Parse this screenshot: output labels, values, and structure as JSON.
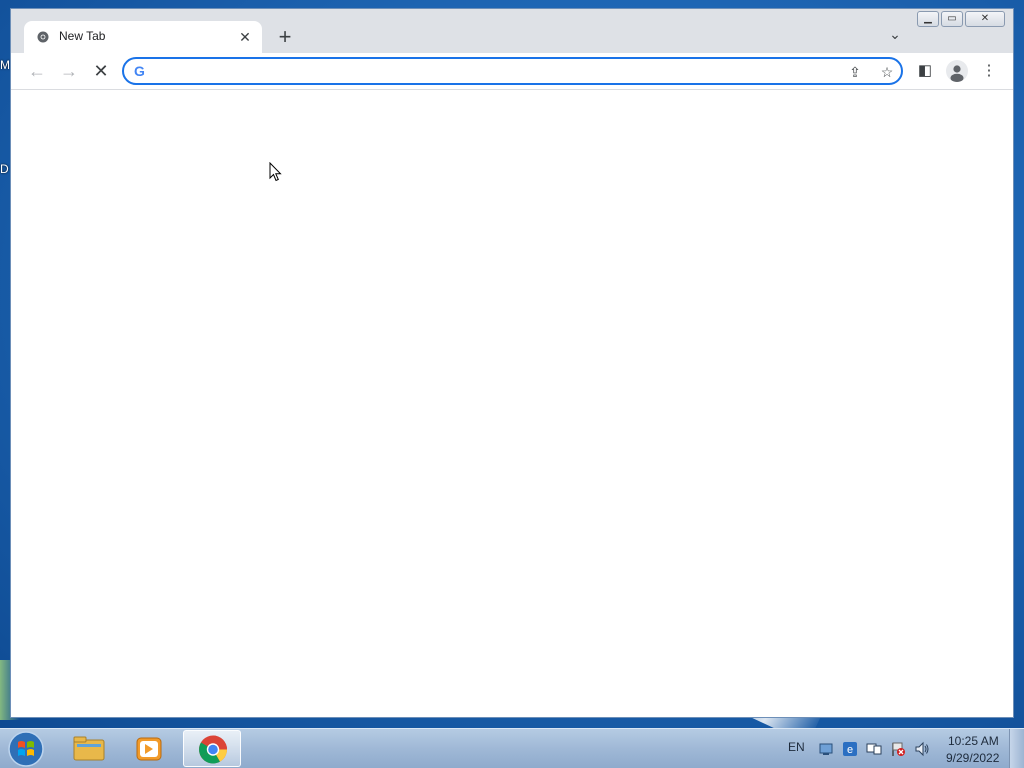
{
  "desktop": {
    "edge_letters": [
      "M",
      "D"
    ]
  },
  "browser": {
    "tab": {
      "title": "New Tab",
      "close_glyph": "✕"
    },
    "new_tab_glyph": "+",
    "tab_search_glyph": "⌄",
    "window_controls": {
      "minimize": "▁",
      "maximize": "▭",
      "close": "✕"
    },
    "toolbar": {
      "back_glyph": "←",
      "forward_glyph": "→",
      "stop_glyph": "✕",
      "omnibox_value": "",
      "omnibox_placeholder": "",
      "google_letter": "G",
      "share_glyph": "⇪",
      "bookmark_glyph": "☆",
      "side_panel_glyph": "◧",
      "menu_glyph": "⋮"
    }
  },
  "taskbar": {
    "language": "EN",
    "time": "10:25 AM",
    "date": "9/29/2022",
    "pinned": [
      "Windows Explorer",
      "Windows Media Player",
      "Google Chrome"
    ]
  },
  "colors": {
    "accent": "#1a73e8",
    "tab_strip": "#dee1e6",
    "desktop": "#1f67b5"
  }
}
